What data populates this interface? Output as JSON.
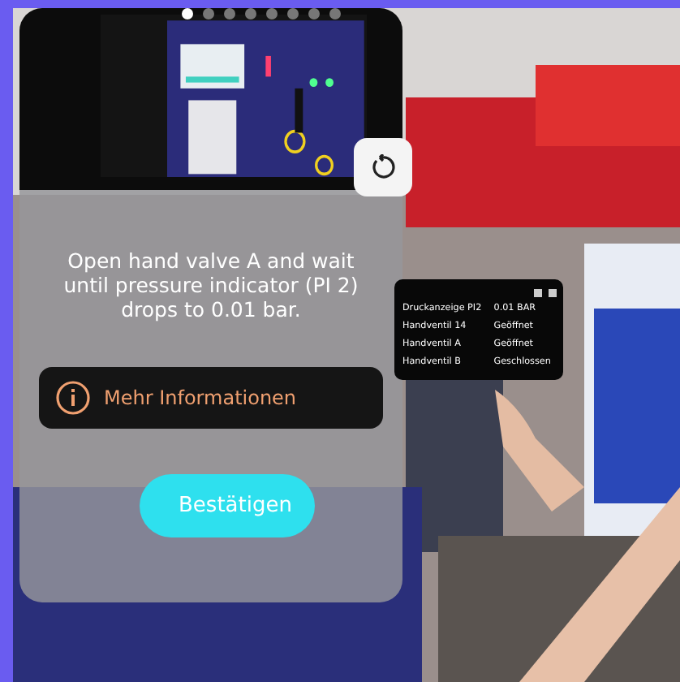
{
  "step_panel": {
    "pages": [
      {
        "selected": true
      },
      {
        "selected": false
      },
      {
        "selected": false
      },
      {
        "selected": false
      },
      {
        "selected": false
      },
      {
        "selected": false
      },
      {
        "selected": false
      },
      {
        "selected": false
      }
    ],
    "instruction": "Open hand valve A and wait until pressure indicator (PI 2) drops to 0.01 bar.",
    "info_button": "Mehr Informationen",
    "confirm_button": "Bestätigen"
  },
  "status_panel": {
    "rows": [
      {
        "label": "Druckanzeige PI2",
        "value": "0.01 BAR"
      },
      {
        "label": "Handventil 14",
        "value": "Geöffnet"
      },
      {
        "label": "Handventil A",
        "value": "Geöffnet"
      },
      {
        "label": "Handventil B",
        "value": "Geschlossen"
      }
    ]
  }
}
